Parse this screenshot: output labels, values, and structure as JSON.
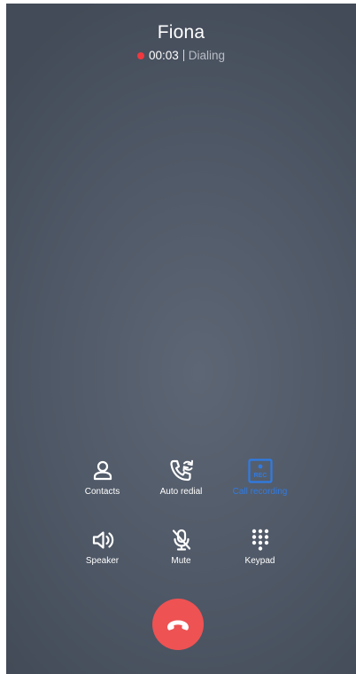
{
  "caller": {
    "name": "Fiona",
    "timer": "00:03",
    "status": "Dialing"
  },
  "controls": {
    "row1": [
      {
        "label": "Contacts",
        "icon": "contacts-icon"
      },
      {
        "label": "Auto redial",
        "icon": "auto-redial-icon"
      },
      {
        "label": "Call recording",
        "icon": "rec-icon",
        "active": true
      }
    ],
    "row2": [
      {
        "label": "Speaker",
        "icon": "speaker-icon"
      },
      {
        "label": "Mute",
        "icon": "mute-icon"
      },
      {
        "label": "Keypad",
        "icon": "keypad-icon"
      }
    ]
  },
  "colors": {
    "recording_dot": "#f0383f",
    "active_accent": "#2f7be5",
    "end_call": "#ee5253"
  },
  "end_call": {
    "icon": "end-call-icon"
  }
}
